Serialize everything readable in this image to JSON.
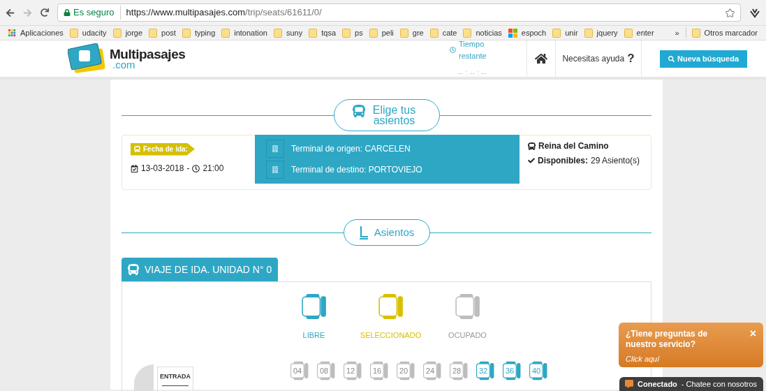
{
  "browser": {
    "security": "Es seguro",
    "url_host": "https://www.multipasajes.com",
    "url_path": "/trip/seats/61611/0/",
    "bookmarks": [
      {
        "label": "Aplicaciones",
        "kind": "apps"
      },
      {
        "label": "udacity",
        "kind": "folder"
      },
      {
        "label": "jorge",
        "kind": "folder"
      },
      {
        "label": "post",
        "kind": "folder"
      },
      {
        "label": "typing",
        "kind": "folder"
      },
      {
        "label": "intonation",
        "kind": "folder"
      },
      {
        "label": "suny",
        "kind": "folder"
      },
      {
        "label": "tqsa",
        "kind": "folder"
      },
      {
        "label": "ps",
        "kind": "folder"
      },
      {
        "label": "peli",
        "kind": "folder"
      },
      {
        "label": "gre",
        "kind": "folder"
      },
      {
        "label": "cate",
        "kind": "folder"
      },
      {
        "label": "noticias",
        "kind": "folder"
      },
      {
        "label": "espoch",
        "kind": "tiles"
      },
      {
        "label": "unir",
        "kind": "folder"
      },
      {
        "label": "jquery",
        "kind": "folder"
      },
      {
        "label": "enter",
        "kind": "folder"
      }
    ],
    "overflow": "»",
    "other_bookmarks": "Otros marcador"
  },
  "header": {
    "logo_name": "Multipasajes",
    "logo_suffix": ".com",
    "timer_label": "Tiempo restante",
    "timer_value": "-- : -- : --",
    "help": "Necesitas ayuda",
    "help_mark": "?",
    "search_button": "Nueva búsqueda"
  },
  "trip": {
    "section_title": "Elige tus asientos",
    "date_label": "Fecha de ida:",
    "date": "13-03-2018",
    "separator": "-",
    "time": "21:00",
    "terminals": [
      {
        "label": "Terminal de origen: CARCELEN"
      },
      {
        "label": "Terminal de destino: PORTOVIEJO"
      }
    ],
    "company": "Reina del Camino",
    "available_label": "Disponibles:",
    "available_value": "29 Asiento(s)"
  },
  "seats_section": {
    "title": "Asientos",
    "tab": "VIAJE DE IDA. UNIDAD N° 0",
    "legend": [
      {
        "label": "LIBRE",
        "kind": "free"
      },
      {
        "label": "SELECCIONADO",
        "kind": "selected"
      },
      {
        "label": "OCUPADO",
        "kind": "occupied"
      }
    ],
    "entrance": "ENTRADA",
    "seats": [
      {
        "number": "04",
        "kind": "occupied"
      },
      {
        "number": "08",
        "kind": "occupied"
      },
      {
        "number": "12",
        "kind": "occupied"
      },
      {
        "number": "16",
        "kind": "occupied"
      },
      {
        "number": "20",
        "kind": "occupied"
      },
      {
        "number": "24",
        "kind": "occupied"
      },
      {
        "number": "28",
        "kind": "occupied"
      },
      {
        "number": "32",
        "kind": "free"
      },
      {
        "number": "36",
        "kind": "free"
      },
      {
        "number": "40",
        "kind": "free"
      }
    ]
  },
  "chat": {
    "question": "¿Tiene preguntas de nuestro servicio?",
    "link": "Click aquí",
    "close": "×",
    "status": "Conectado",
    "status_text": "- Chatee con nosotros"
  }
}
